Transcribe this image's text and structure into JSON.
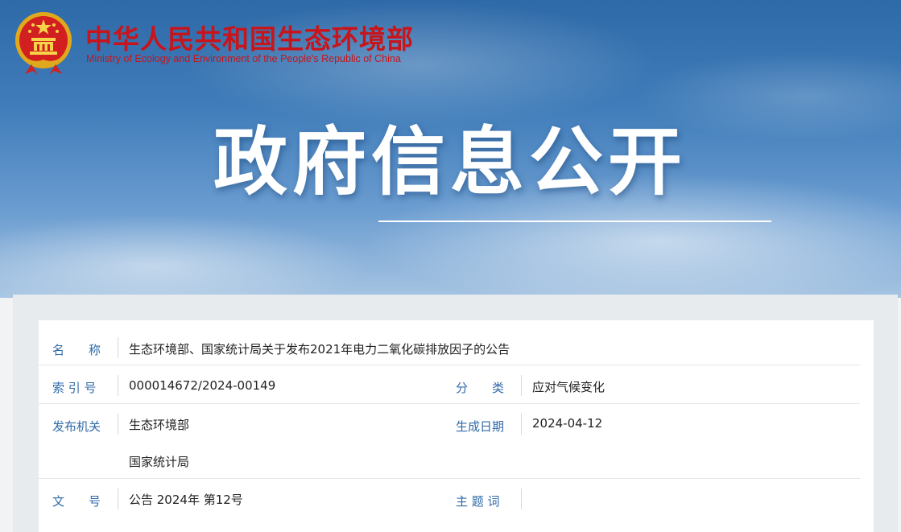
{
  "header": {
    "ministry_cn": "中华人民共和国生态环境部",
    "ministry_en": "Ministry of Ecology and Environment of the People's Republic of China",
    "emblem_icon": "national-emblem-icon",
    "banner_title": "政府信息公开"
  },
  "colors": {
    "brand_red": "#c8141a",
    "label_blue": "#2f6aa8",
    "sky_blue": "#3f7cb9"
  },
  "info": {
    "name": {
      "label": "名　　称",
      "value": "生态环境部、国家统计局关于发布2021年电力二氧化碳排放因子的公告"
    },
    "index": {
      "label": "索 引 号",
      "value": "000014672/2024-00149"
    },
    "category": {
      "label": "分　　类",
      "value": "应对气候变化"
    },
    "issuer": {
      "label": "发布机关",
      "values": [
        "生态环境部",
        "国家统计局"
      ]
    },
    "date": {
      "label": "生成日期",
      "value": "2024-04-12"
    },
    "doc_no": {
      "label": "文　　号",
      "value": "公告 2024年 第12号"
    },
    "topic": {
      "label": "主 题 词",
      "value": ""
    }
  }
}
